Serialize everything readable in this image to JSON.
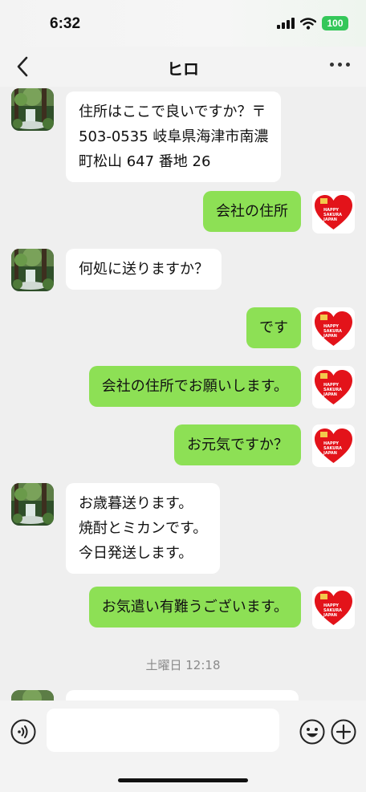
{
  "status_bar": {
    "time": "6:32",
    "battery": "100"
  },
  "header": {
    "title": "ヒロ"
  },
  "messages": [
    {
      "side": "in",
      "text": "住所はここで良いですか？〒\n503-0535 岐阜県海津市南濃\n町松山 647 番地 26"
    },
    {
      "side": "out",
      "text": "会社の住所"
    },
    {
      "side": "in",
      "text": "何処に送りますか？"
    },
    {
      "side": "out",
      "text": "です"
    },
    {
      "side": "out",
      "text": "会社の住所でお願いします。"
    },
    {
      "side": "out",
      "text": "お元気ですか？"
    },
    {
      "side": "in",
      "text": "お歳暮送ります。\n焼酎とミカンです。\n今日発送します。"
    },
    {
      "side": "out",
      "text": "お気遣い有難うございます。"
    }
  ],
  "date_separator": "土曜日 12:18",
  "stickers": {
    "heart_text": "HAPPY SAKURA JAPAN"
  },
  "colors": {
    "outgoing_bubble": "#8de055",
    "incoming_bubble": "#ffffff",
    "heart": "#e3131a",
    "background": "#efefef"
  },
  "icons": {
    "back": "chevron-left-icon",
    "more": "ellipsis-icon",
    "voice": "voice-icon",
    "emoji": "emoji-icon",
    "plus": "plus-icon"
  }
}
